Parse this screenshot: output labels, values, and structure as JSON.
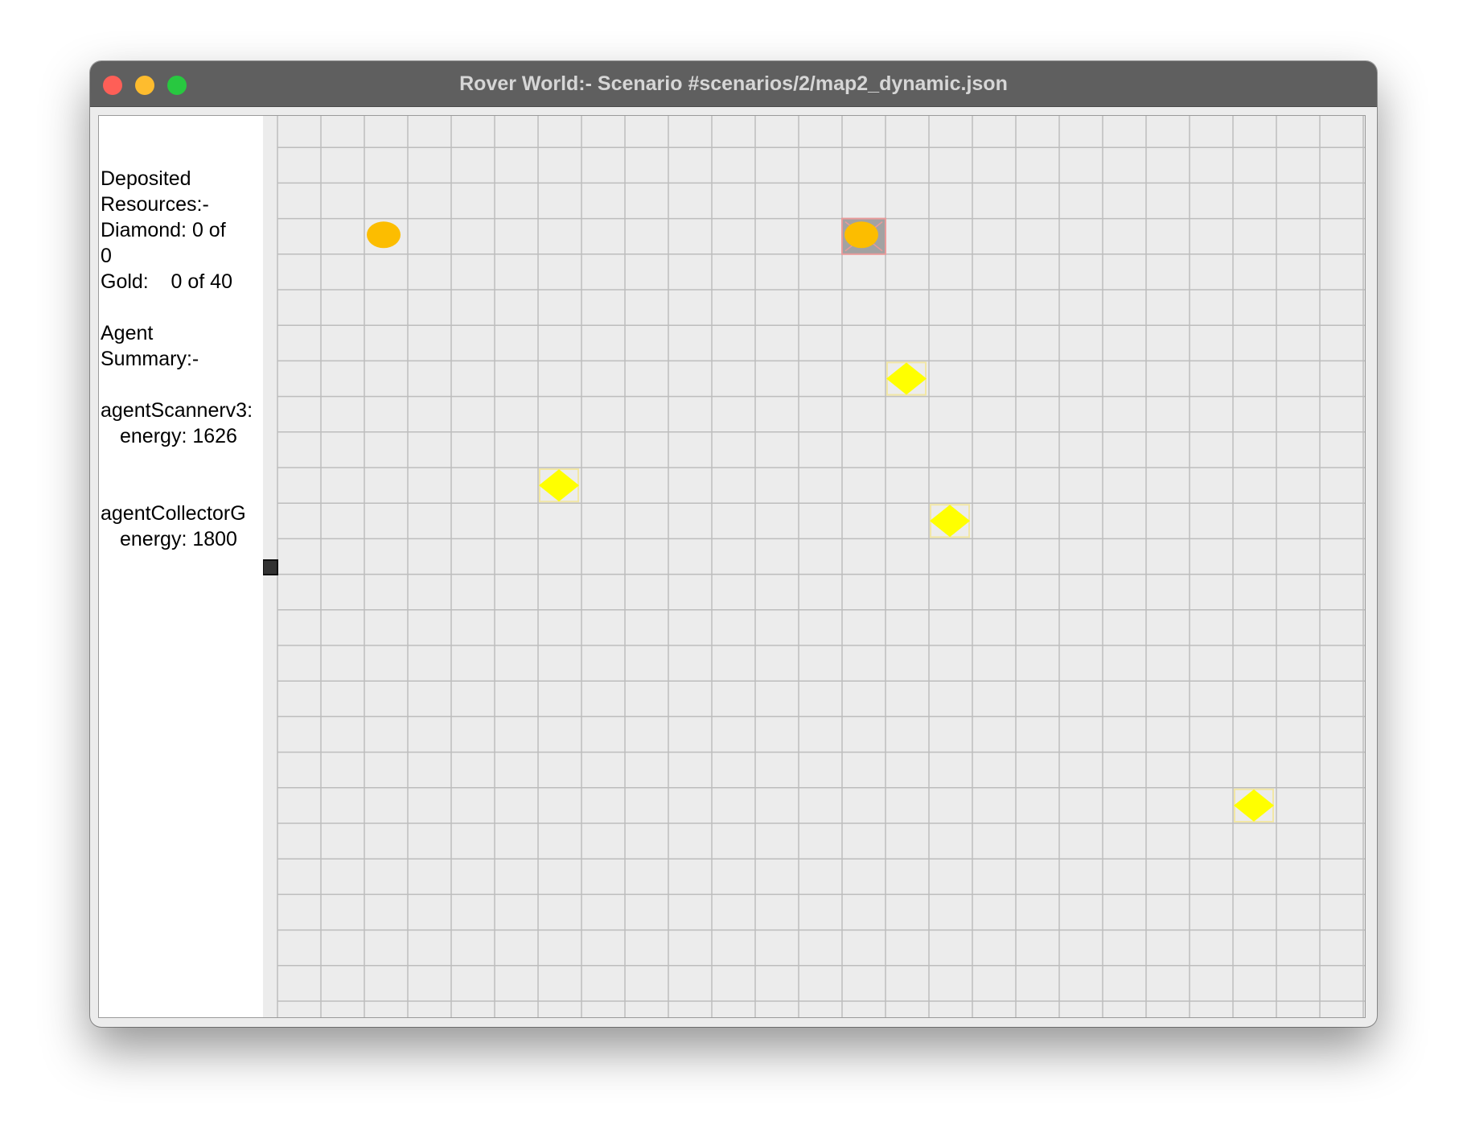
{
  "window": {
    "title": "Rover World:- Scenario #scenarios/2/map2_dynamic.json"
  },
  "sidebar": {
    "deposited_heading_1": "Deposited",
    "deposited_heading_2": "Resources:-",
    "diamond_line_1": "Diamond: 0 of",
    "diamond_line_2": "0",
    "gold_line": "Gold:    0 of 40",
    "agent_heading_1": "Agent",
    "agent_heading_2": "Summary:-",
    "agents": [
      {
        "name": "agentScannerv3:",
        "energy": "energy: 1626"
      },
      {
        "name": "agentCollectorG",
        "energy": "energy: 1800"
      }
    ]
  },
  "map": {
    "columns": 25,
    "rows": 25,
    "gold": [
      {
        "col": 2,
        "row": 3,
        "highlighted": false
      },
      {
        "col": 13,
        "row": 3,
        "highlighted": true
      }
    ],
    "diamonds": [
      {
        "col": 14,
        "row": 7
      },
      {
        "col": 6,
        "row": 10
      },
      {
        "col": 15,
        "row": 11
      },
      {
        "col": 22,
        "row": 19
      }
    ],
    "colors": {
      "background": "#ececec",
      "grid_line": "#bdbdbd",
      "gold": "#fcbd00",
      "diamond": "#ffff00",
      "diamond_border": "#f2e7a6",
      "highlight_fill": "#a2a2a2",
      "highlight_border": "#e89a9a",
      "agent": "#333333"
    }
  }
}
